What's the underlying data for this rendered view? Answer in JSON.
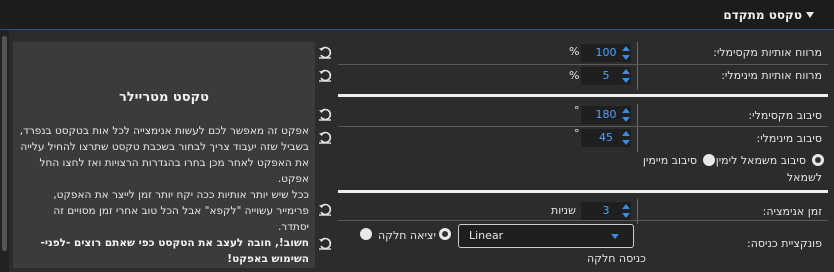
{
  "header": {
    "title": "טקסט מתקדם",
    "toggle_icon": "caret-down-icon"
  },
  "panel": {
    "title": "טקסט מטריילר",
    "p1": "אפקט זה מאפשר לכם לעשות אנימצייה לכל אות בטקסט בנפרד, בשביל שזה יעבוד צריך לבחור בשכבת טקסט שתרצו להחיל עלייה את האפקט לאחר מכן בחרו בהגדרות הרצויות ואז לחצו החל אפקט.",
    "p2": "ככל שיש יותר אותיות ככה יקח יותר זמן לייצר את האפקט, פרימייר עשוייה \"לקפא\" אבל הכל טוב אחרי זמן מסויים זה יסתדר.",
    "p3_bold": "חשוב!, חובה לעצב את הטקסט כפי שאתם רוצים -לפני- השימוש באפקט!"
  },
  "fields": {
    "max_spacing": {
      "label": "מרווח אותיות מקסימלי:",
      "value": "100",
      "unit": "%"
    },
    "min_spacing": {
      "label": "מרווח אותיות מינימלי:",
      "value": "5",
      "unit": "%"
    },
    "max_rotation": {
      "label": "סיבוב מקסימלי:",
      "value": "180",
      "unit": "°"
    },
    "min_rotation": {
      "label": "סיבוב מינימלי:",
      "value": "45",
      "unit": "°"
    },
    "rotation_dir": {
      "option1": "סיבוב משמאל לימין",
      "option1_wrap": "לשמאל",
      "option2": "סיבוב מיימין",
      "selected": "option1"
    },
    "anim_time": {
      "label": "זמן אנימציה:",
      "value": "3",
      "unit": "שניות"
    },
    "easing": {
      "label": "פונקציית כניסה:",
      "select_value": "Linear",
      "opt_smooth_in": "כניסה חלקה",
      "opt_smooth_out": "יציאה חלקה",
      "smooth_in_checked": true,
      "smooth_out_checked": false
    }
  },
  "icons": {
    "reset": "reset-icon"
  },
  "colors": {
    "accent": "#3d8ae0",
    "value_text": "#4aa3ff",
    "header_border": "#2a4f8a"
  }
}
